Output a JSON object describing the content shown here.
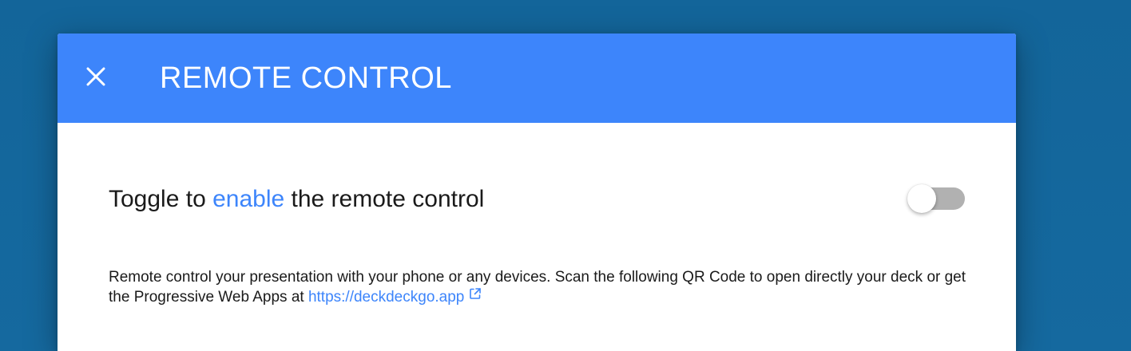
{
  "dialog": {
    "title": "REMOTE CONTROL",
    "close_icon": "close-icon",
    "toggle": {
      "prefix": "Toggle to ",
      "action": "enable",
      "suffix": " the remote control",
      "state": "off"
    },
    "description": {
      "text": "Remote control your presentation with your phone or any devices. Scan the following QR Code to open directly your deck or get the Progressive Web Apps at ",
      "link_text": "https://deckdeckgo.app",
      "link_icon": "external-link-icon"
    }
  },
  "colors": {
    "backdrop": "#13679c",
    "toolbar": "#3d85fb",
    "accent": "#3d85fb",
    "toggle_track_off": "#b1b1b1"
  }
}
